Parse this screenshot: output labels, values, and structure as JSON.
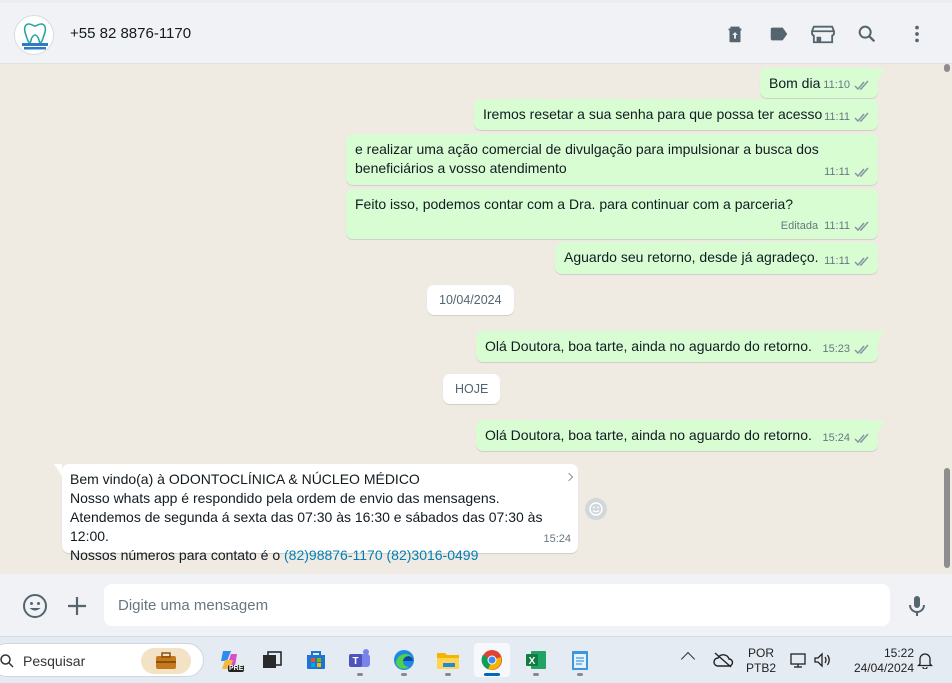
{
  "header": {
    "contact_name": "+55 82 8876-1170",
    "avatar_text": "Odontoclínica & Núcleo Médico"
  },
  "messages_out": [
    {
      "text": "Bom dia",
      "time": "11:10"
    },
    {
      "text": "Iremos resetar a sua senha para que possa ter acesso",
      "time": "11:11"
    },
    {
      "text": "e realizar uma ação comercial de divulgação para impulsionar a busca dos beneficiários a vosso atendimento",
      "time": "11:11"
    },
    {
      "text": "Feito isso, podemos contar com a Dra. para continuar com a parceria?",
      "time": "11:11",
      "edited": "Editada"
    },
    {
      "text": "Aguardo seu retorno, desde já agradeço.",
      "time": "11:11"
    },
    {
      "text": "Olá Doutora, boa tarte, ainda no aguardo do retorno.",
      "time": "15:23"
    },
    {
      "text": "Olá Doutora, boa tarte, ainda no aguardo do retorno.",
      "time": "15:24"
    }
  ],
  "date_chips": [
    "10/04/2024",
    "HOJE"
  ],
  "message_in": {
    "line1": "Bem vindo(a) à ODONTOCLÍNICA & NÚCLEO MÉDICO",
    "line2": "Nosso whats app é respondido pela ordem de envio das mensagens.",
    "line3": "Atendemos de segunda á sexta das 07:30 às 16:30 e sábados das 07:30 às 12:00.",
    "line4_prefix": "Nossos números para contato é o ",
    "link1": "(82)98876-1170",
    "link2": "(82)3016-0499",
    "time": "15:24"
  },
  "composer": {
    "placeholder": "Digite uma mensagem"
  },
  "taskbar": {
    "search_label": "Pesquisar",
    "lang_line1": "POR",
    "lang_line2": "PTB2",
    "time": "15:22",
    "date": "24/04/2024"
  },
  "colors": {
    "outgoing_bubble": "#d9fdd3",
    "incoming_bubble": "#ffffff",
    "chat_bg": "#efeae2",
    "link": "#027eb5",
    "header_bg": "#f0f2f5"
  }
}
